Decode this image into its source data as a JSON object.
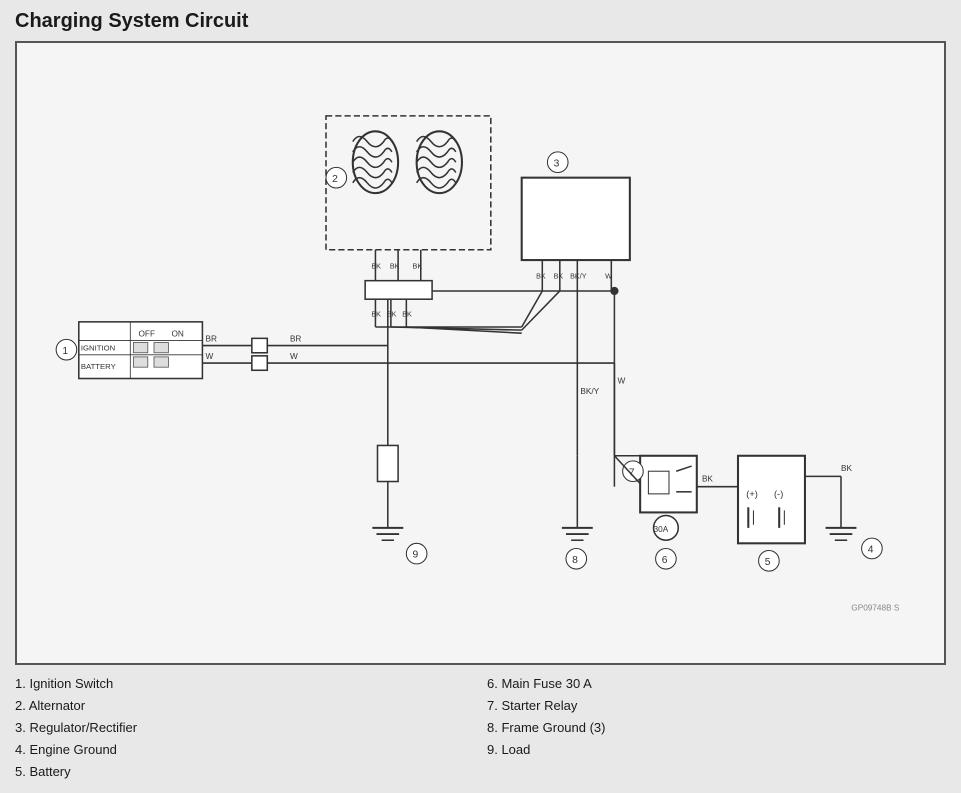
{
  "title": "Charging System Circuit",
  "legend": [
    {
      "number": "1",
      "label": "Ignition Switch"
    },
    {
      "number": "2",
      "label": "Alternator"
    },
    {
      "number": "3",
      "label": "Regulator/Rectifier"
    },
    {
      "number": "4",
      "label": "Engine Ground"
    },
    {
      "number": "5",
      "label": "Battery"
    },
    {
      "number": "6",
      "label": "Main Fuse 30 A"
    },
    {
      "number": "7",
      "label": "Starter Relay"
    },
    {
      "number": "8",
      "label": "Frame Ground (3)"
    },
    {
      "number": "9",
      "label": "Load"
    }
  ],
  "diagram_note": "GP09748B S"
}
